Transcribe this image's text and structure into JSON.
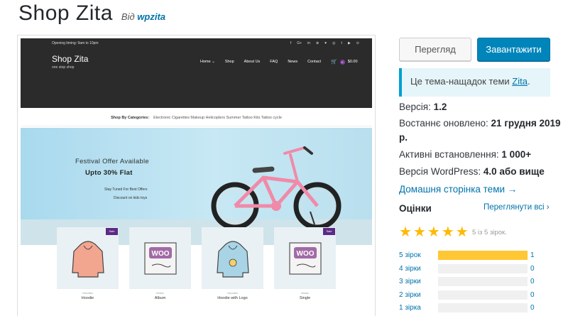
{
  "title": "Shop Zita",
  "by_prefix": "Від",
  "author": "wpzita",
  "screenshot": {
    "opening": "Opening timing: 9am to 10pm",
    "social_icons": [
      "f",
      "G+",
      "in",
      "⊕",
      "♥",
      "◎",
      "t",
      "▶",
      "⊙"
    ],
    "site_name": "Shop Zita",
    "tagline": "one stop shop",
    "menu": [
      "Home ⌄",
      "Shop",
      "About Us",
      "FAQ",
      "News",
      "Contact"
    ],
    "cart_count": "0",
    "cart_total": "$0.00",
    "categories_label": "Shop By Categories:",
    "categories": "Electronic Cigarettes Makeup Helicopters Summer Tattoo Kits Tattoo cycle",
    "hero_line1": "Festival Offer Available",
    "hero_line2": "Upto 30% Flat",
    "hero_line3": "Stay Tuned For Best Offers",
    "hero_line4": "Discount on kids toys",
    "products": [
      {
        "name": "Hoodie",
        "category": "Hoodies",
        "sale": "Sale",
        "img": "hoodie"
      },
      {
        "name": "Album",
        "category": "Music",
        "sale": "",
        "img": "woo"
      },
      {
        "name": "Hoodie with Logo",
        "category": "Hoodies",
        "sale": "",
        "img": "hoodie-logo"
      },
      {
        "name": "Single",
        "category": "Music",
        "sale": "Sale",
        "img": "woo"
      }
    ]
  },
  "preview_button": "Перегляд",
  "download_button": "Завантажити",
  "notice_text": "Це тема-нащадок теми ",
  "notice_link": "Zita",
  "notice_end": ".",
  "version_label": "Версія: ",
  "version_value": "1.2",
  "updated_label": "Востаннє оновлено: ",
  "updated_value_a": "21 грудня 2019",
  "updated_value_b": "р.",
  "installs_label": "Активні встановлення: ",
  "installs_value": "1 000+",
  "wp_label": "Версія WordPress: ",
  "wp_value": "4.0 або вище",
  "homepage_link": "Домашня сторінка теми →",
  "ratings_title": "Оцінки",
  "all_reviews": "Переглянути всі ›",
  "rating_value": 5,
  "rating_text": "5 із 5 зірок.",
  "rating_bars": [
    {
      "label": "5 зірок",
      "count": "1",
      "fraction": 1.0
    },
    {
      "label": "4 зірки",
      "count": "0",
      "fraction": 0
    },
    {
      "label": "3 зірки",
      "count": "0",
      "fraction": 0
    },
    {
      "label": "2 зірки",
      "count": "0",
      "fraction": 0
    },
    {
      "label": "1 зірка",
      "count": "0",
      "fraction": 0
    }
  ],
  "colors": {
    "accent": "#0073aa",
    "button": "#0085ba",
    "star": "#ffb900",
    "bar": "#ffc733",
    "sale": "#5b2a86"
  }
}
